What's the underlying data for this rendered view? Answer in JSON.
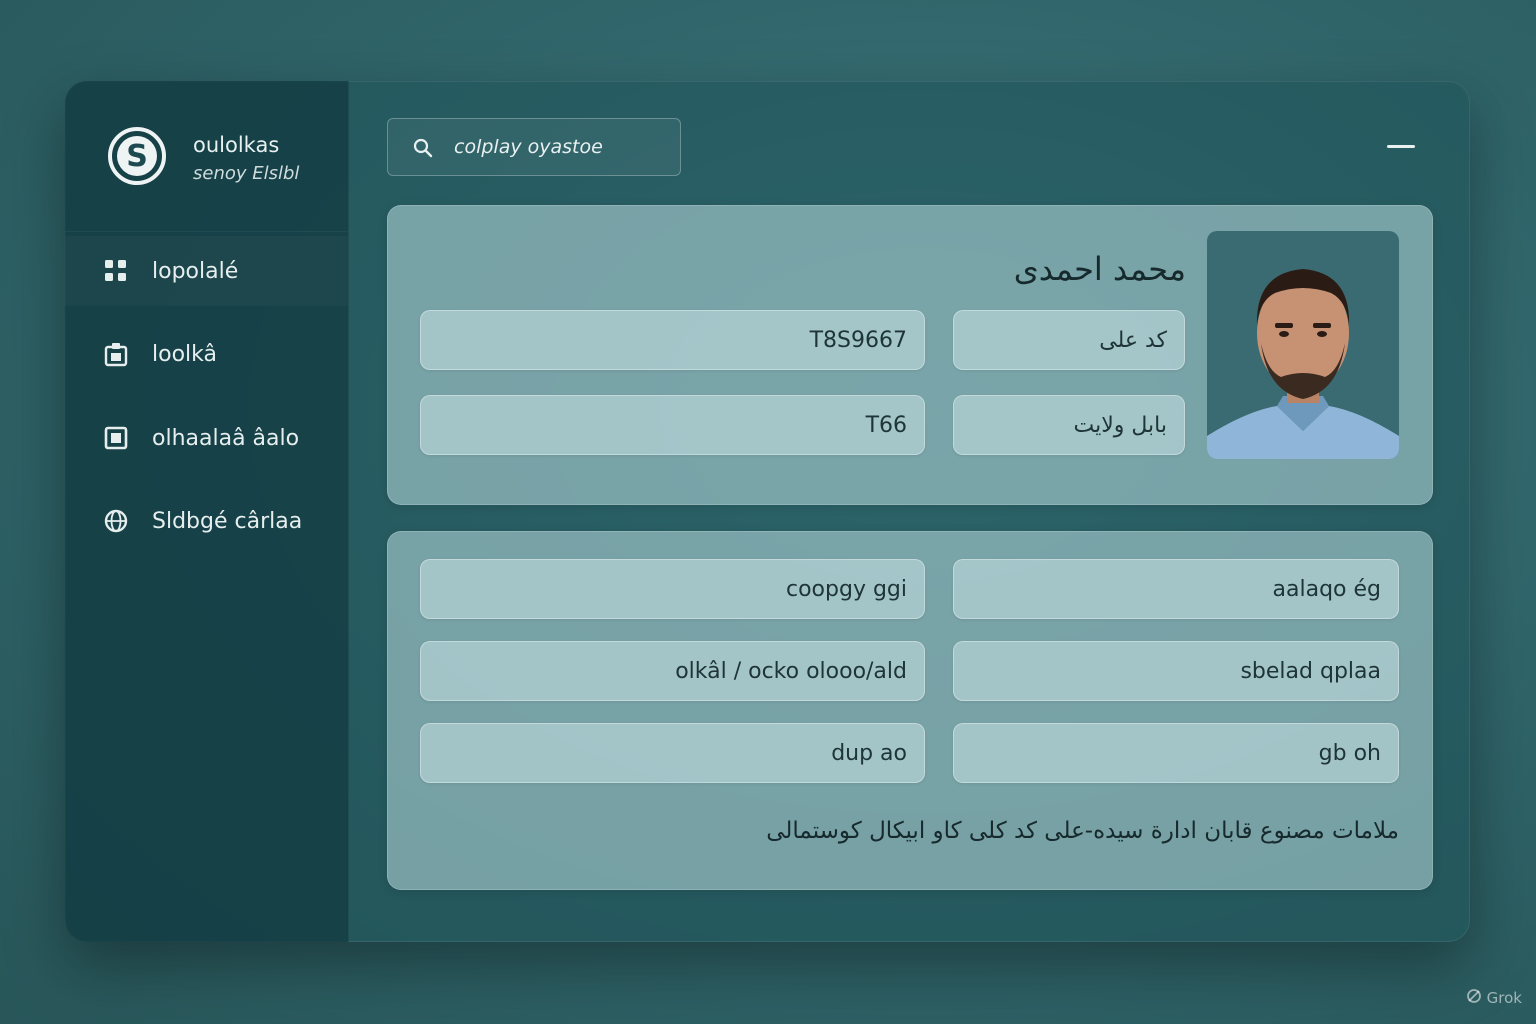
{
  "app": {
    "brand_name": "oulolkas",
    "brand_sub": "senoy Elslbl",
    "logo_letter": "S"
  },
  "search": {
    "placeholder": "colplay oyastoe"
  },
  "sidebar": {
    "items": [
      {
        "label": "lopolalé",
        "icon": "grid-icon"
      },
      {
        "label": "loolkâ",
        "icon": "id-card-icon"
      },
      {
        "label": "olhaalaâ âalo",
        "icon": "square-icon"
      },
      {
        "label": "Sldbgé cârlaa",
        "icon": "globe-icon"
      }
    ]
  },
  "profile": {
    "name": "محمد احمدی",
    "fields": {
      "code_value": "T8S9667",
      "first_label": "کد علی",
      "number_value": "T66",
      "second_label": "بابل ولایت"
    }
  },
  "details": {
    "rows": [
      {
        "left": "coopgy ggi",
        "right": "aalaqo ég"
      },
      {
        "left": "olkâl / ocko olooo/ald",
        "right": "sbelad qplaa"
      },
      {
        "left": "dup ao",
        "right": "gb oh"
      }
    ],
    "note": "ملامات مصنوع قابان ادارة سیده-علی کد کلی کاو ابیکال کوستمالی"
  },
  "watermark": {
    "text": "Grok"
  },
  "colors": {
    "background": "#2f6469",
    "sidebar": "#16444a",
    "card": "#a9cacd",
    "field": "#c6dfe0",
    "text_dark": "#1e3437",
    "text_light": "#e8f0f0"
  }
}
